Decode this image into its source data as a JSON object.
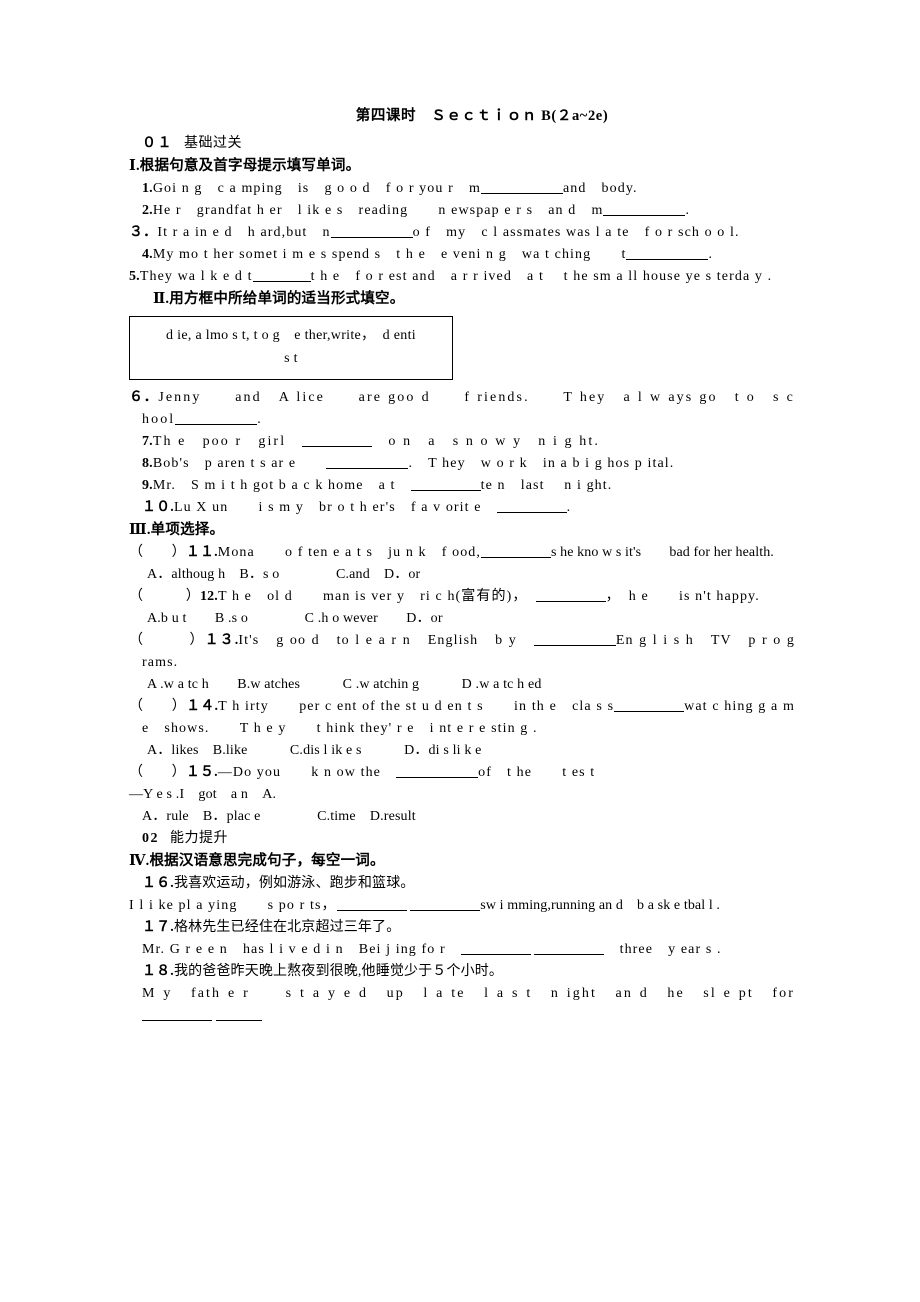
{
  "document": {
    "title": "第四课时　Ｓｅｃｔｉｏｎ B(２a~2e)",
    "sections": [
      {
        "id": "01",
        "number": "０１",
        "label": "基础过关"
      },
      {
        "id": "02",
        "number": "02",
        "label": "能力提升"
      }
    ]
  },
  "part1": {
    "heading": "Ⅰ.根据句意及首字母提示填写单词。",
    "items": [
      {
        "num": "1.",
        "text_before": "Goi n g　c a mping　is　g o o d　f o r you r　m",
        "blank": "xl",
        "text_after": "and　body."
      },
      {
        "num": "2.",
        "text_before": "He r　grandfat h er　l ik e s　reading　　n ewspap e r s　an d　m",
        "blank": "xl",
        "text_after": "."
      },
      {
        "num": "３．",
        "text_before": "It r a in e d　h ard,but　n",
        "blank": "xl",
        "text_after": "o f　my　c l assmates was l a te　f o r sch o o l."
      },
      {
        "num": "4.",
        "text_before": "My mo t her somet i m e s spend s　t h e　e veni n g　wa t ching　　t",
        "blank": "xl",
        "text_after": "."
      },
      {
        "num": "5.",
        "text_before": "They wa l k e d t",
        "blank": "m",
        "text_after": "t h e　f o r est and　a r r ived　a t　 t he sm a ll house ye s terda y ."
      }
    ]
  },
  "part2": {
    "heading": "Ⅱ.用方框中所给单词的适当形式填空。",
    "wordbank_line1": "d ie, a lmo s t, t o g　e ther,write，　d enti",
    "wordbank_line2": "s t",
    "items": [
      {
        "num": "６．",
        "text_before": "Jenny　　and　A lice　　are goo d　　f riends.　　T hey　a l w ays go　t o　s c hool",
        "blank": "xl",
        "text_after": "."
      },
      {
        "num": "7.",
        "text_before": "Th e　poo r　girl　",
        "blank": "l",
        "text_after": "　o n　a　s n o w y　n i g ht."
      },
      {
        "num": "8.",
        "text_before": "Bob's　p aren t s ar e　　",
        "blank": "xl",
        "text_after": ".　T hey　w o r k　in a b i g hos p ital."
      },
      {
        "num": "9.",
        "text_before": "Mr.　S m i t h got b a c k home　a t　",
        "blank": "l",
        "text_after": "te n　last　 n i ght."
      },
      {
        "num": "１０.",
        "text_before": "Lu X un　　i s m y　br o t h er's　f a v orit e　",
        "blank": "l",
        "text_after": "."
      }
    ]
  },
  "part3": {
    "heading": "Ⅲ.单项选择。",
    "items": [
      {
        "bracket": "（　　）",
        "num": "１１.",
        "stem_before": "Mona　　o f ten e a t s　ju n k　f ood,",
        "blank": "l",
        "stem_after": "s he kno w s it's　　bad for her health.",
        "options": "A．althoug h　B．s o　　　　C.and　D．or"
      },
      {
        "bracket": "（　　　）",
        "num": "12.",
        "stem_before": "T h e　ol d　　man is ver y　ri c h(富有的)，　",
        "blank": "l",
        "stem_after": "，　h e　　is n't happy.",
        "options": "A.b u t　　B .s o　　　　C .h o wever　　D．or"
      },
      {
        "bracket": "（　　　）",
        "num": "１３.",
        "stem_before": "It's　g oo d　to l e a r n　English　b y　",
        "blank": "xl",
        "stem_after": "En g l i s h　TV　p r o g rams.",
        "options": "A .w a tc h　　B.w atches　　　C .w atchin g　　　D .w a tc h ed"
      },
      {
        "bracket": "（　　）",
        "num": "１４.",
        "stem_before": "T h irty　　per c ent of the st u d en t s　　in th e　cla s s",
        "blank": "l",
        "stem_after": "wat c hing g a m e　shows.　　T h e y　　t hink they' r e　i nt e r e stin g .",
        "options": "A．likes　B.like　　　C.dis l ik e s　　　D．di s li k e"
      },
      {
        "bracket": "（　　）",
        "num": "１５.",
        "stem_before": "—Do you　　k n ow the　",
        "blank": "xl",
        "stem_after": "of　t he　　t es t",
        "answer_line": "—Y e s .I　got　a n　A.",
        "options": "A．rule　B．plac e　　　　C.time　D.result"
      }
    ]
  },
  "part4": {
    "heading": "Ⅳ.根据汉语意思完成句子，每空一词。",
    "items": [
      {
        "num": "１６.",
        "chinese": "我喜欢运动，例如游泳、跑步和篮球。",
        "english_before": "I l i ke pl a ying　　s po r ts，",
        "blank1": "l",
        "blank2": "l",
        "english_after": "sw i mming,running an d　b a sk e tbal l ."
      },
      {
        "num": "１７.",
        "chinese": "格林先生已经住在北京超过三年了。",
        "english_before": "Mr. G r e e n　has l i v e d i n　Bei j ing fo r　",
        "blank1": "l",
        "blank2": "l",
        "english_after": "　three　y ear s ."
      },
      {
        "num": "１８.",
        "chinese": "我的爸爸昨天晚上熬夜到很晚,他睡觉少于５个小时。",
        "english_before": "M y　fath e r　　s t a y e d　up　l a te　l a s t　n ight　an d　he　sl e pt　for",
        "blank1": "l",
        "blank2": "s",
        "english_after": ""
      }
    ]
  }
}
